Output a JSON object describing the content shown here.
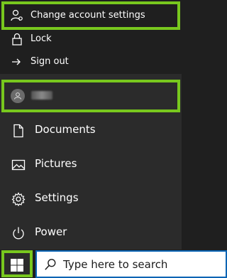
{
  "account_flyout": {
    "change_settings_label": "Change account settings",
    "lock_label": "Lock",
    "sign_out_label": "Sign out"
  },
  "menu": {
    "items": [
      {
        "label": "Documents",
        "icon": "document-icon"
      },
      {
        "label": "Pictures",
        "icon": "pictures-icon"
      },
      {
        "label": "Settings",
        "icon": "gear-icon"
      },
      {
        "label": "Power",
        "icon": "power-icon"
      }
    ]
  },
  "taskbar": {
    "search_placeholder": "Type here to search"
  },
  "colors": {
    "highlight": "#78c81e",
    "search_border": "#0a64b4"
  }
}
